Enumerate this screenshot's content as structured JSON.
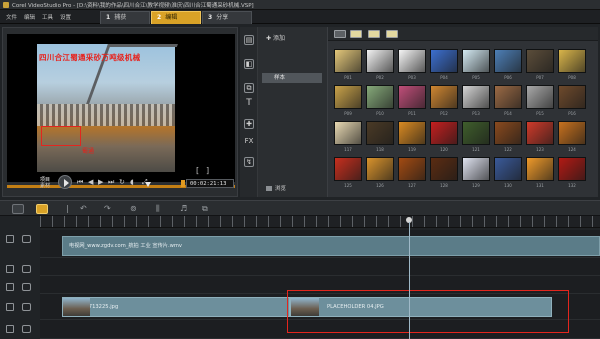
{
  "window": {
    "title": "Corel VideoStudio Pro - [D:\\资料\\我的作品\\四川合江\\教学视频\\淮庆\\四川合江蜀通采砂机械.VSP]"
  },
  "menu": {
    "items": [
      "文件",
      "编辑",
      "工具",
      "设置"
    ]
  },
  "steps": [
    {
      "num": "1",
      "label": "捕获"
    },
    {
      "num": "2",
      "label": "编辑"
    },
    {
      "num": "3",
      "label": "分享"
    }
  ],
  "preview": {
    "overlay_text": "四川合江蜀通采砂万吨级机械",
    "overlay_mark": "蜀通",
    "mode_project": "项目",
    "mode_clip": "素材",
    "bracket_in": "[",
    "bracket_out": "]",
    "timecode": "00:02:21:13"
  },
  "library": {
    "add_label": "添加",
    "folder_label": "样本",
    "browse_label": "浏览",
    "thumb_labels": [
      "P01",
      "P02",
      "P03",
      "P04",
      "P05",
      "P06",
      "P07",
      "P08",
      "P09",
      "P10",
      "P11",
      "P12",
      "P13",
      "P14",
      "P15",
      "P16",
      "117",
      "118",
      "119",
      "120",
      "121",
      "122",
      "123",
      "124",
      "125",
      "126",
      "127",
      "128",
      "129",
      "130",
      "131",
      "132"
    ],
    "thumb_colors": [
      "#e3c77a",
      "#f2f2f2",
      "#f5f5f5",
      "#3c6fd0",
      "#d3e9f2",
      "#4d7fb7",
      "#5b4d3a",
      "#d9b54a",
      "#c9a24a",
      "#86aa7a",
      "#c04e79",
      "#cf8631",
      "#d4d4d4",
      "#9b6a45",
      "#a9a9a9",
      "#6e4a2c",
      "#e8d9b3",
      "#4a3a26",
      "#d98a22",
      "#c41f1f",
      "#3f5e2c",
      "#8a4a1e",
      "#cf3a2a",
      "#c7711e",
      "#c72f1e",
      "#d9932c",
      "#a34b12",
      "#5b2c12",
      "#dfe3f0",
      "#3a5a9a",
      "#ef9a2a",
      "#b21a14"
    ]
  },
  "timeline": {
    "title_clip": "电视网_www.zgdv.com_航拍 工业 宣传片.wmv",
    "video_clip_1": "15-1713225.jpg",
    "video_clip_2": "PLACEHOLDER 04.JPG"
  }
}
